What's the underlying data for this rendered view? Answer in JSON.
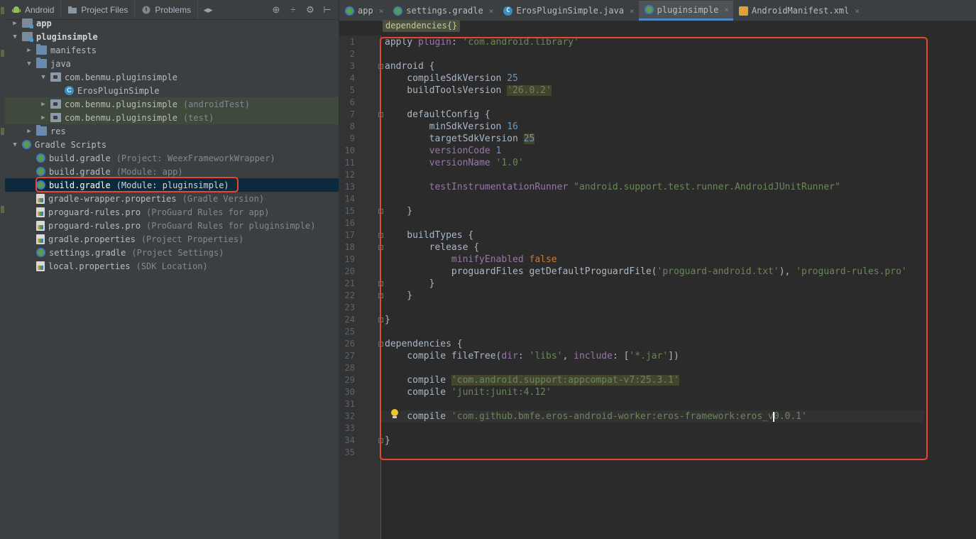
{
  "colors": {
    "panel_bg": "#3c3f41",
    "editor_bg": "#2b2b2b",
    "selection": "#0d293e",
    "highlight_border": "#e8462f",
    "keyword": "#cc7832",
    "string": "#6a8759",
    "number": "#6897bb",
    "property": "#9876aa"
  },
  "project_toolbar": {
    "tabs": [
      {
        "label": "Android",
        "icon": "android-icon"
      },
      {
        "label": "Project Files",
        "icon": "folder-icon"
      },
      {
        "label": "Problems",
        "icon": "problems-icon"
      }
    ],
    "icons": [
      "scroll-arrows-icon",
      "target-icon",
      "collapse-icon",
      "gear-icon",
      "hide-icon"
    ]
  },
  "tree": [
    {
      "label": "app",
      "hint": "",
      "icon": "module-icon",
      "arrow": "▶",
      "bold": true
    },
    {
      "label": "pluginsimple",
      "hint": "",
      "icon": "module-icon",
      "arrow": "▼",
      "bold": true
    },
    {
      "label": "manifests",
      "hint": "",
      "icon": "folder-icon",
      "arrow": "▶"
    },
    {
      "label": "java",
      "hint": "",
      "icon": "folder-icon",
      "arrow": "▼"
    },
    {
      "label": "com.benmu.pluginsimple",
      "hint": "",
      "icon": "package-icon",
      "arrow": "▼"
    },
    {
      "label": "ErosPluginSimple",
      "hint": "",
      "icon": "class-icon",
      "arrow": ""
    },
    {
      "label": "com.benmu.pluginsimple",
      "hint": "(androidTest)",
      "icon": "package-icon",
      "arrow": "▶"
    },
    {
      "label": "com.benmu.pluginsimple",
      "hint": "(test)",
      "icon": "package-icon",
      "arrow": "▶"
    },
    {
      "label": "res",
      "hint": "",
      "icon": "folder-icon",
      "arrow": "▶"
    },
    {
      "label": "Gradle Scripts",
      "hint": "",
      "icon": "gradle-icon",
      "arrow": "▼"
    },
    {
      "label": "build.gradle",
      "hint": "(Project: WeexFrameworkWrapper)",
      "icon": "gradle-icon",
      "arrow": ""
    },
    {
      "label": "build.gradle",
      "hint": "(Module: app)",
      "icon": "gradle-icon",
      "arrow": ""
    },
    {
      "label": "build.gradle",
      "hint": "(Module: pluginsimple)",
      "icon": "gradle-icon",
      "arrow": ""
    },
    {
      "label": "gradle-wrapper.properties",
      "hint": "(Gradle Version)",
      "icon": "properties-icon",
      "arrow": ""
    },
    {
      "label": "proguard-rules.pro",
      "hint": "(ProGuard Rules for app)",
      "icon": "properties-icon",
      "arrow": ""
    },
    {
      "label": "proguard-rules.pro",
      "hint": "(ProGuard Rules for pluginsimple)",
      "icon": "properties-icon",
      "arrow": ""
    },
    {
      "label": "gradle.properties",
      "hint": "(Project Properties)",
      "icon": "properties-icon",
      "arrow": ""
    },
    {
      "label": "settings.gradle",
      "hint": "(Project Settings)",
      "icon": "gradle-icon",
      "arrow": ""
    },
    {
      "label": "local.properties",
      "hint": "(SDK Location)",
      "icon": "properties-icon",
      "arrow": ""
    }
  ],
  "selected_item": "build.gradle (Module: pluginsimple)",
  "editor_tabs": [
    {
      "label": "app",
      "icon": "gradle-icon",
      "active": false
    },
    {
      "label": "settings.gradle",
      "icon": "gradle-icon",
      "active": false
    },
    {
      "label": "ErosPluginSimple.java",
      "icon": "class-icon",
      "active": false
    },
    {
      "label": "pluginsimple",
      "icon": "gradle-icon",
      "active": true
    },
    {
      "label": "AndroidManifest.xml",
      "icon": "xml-icon",
      "active": false
    }
  ],
  "breadcrumb": "dependencies{}",
  "code_lines": [
    "apply plugin: 'com.android.library'",
    "",
    "android {",
    "    compileSdkVersion 25",
    "    buildToolsVersion '26.0.2'",
    "",
    "    defaultConfig {",
    "        minSdkVersion 16",
    "        targetSdkVersion 25",
    "        versionCode 1",
    "        versionName '1.0'",
    "",
    "        testInstrumentationRunner \"android.support.test.runner.AndroidJUnitRunner\"",
    "",
    "    }",
    "",
    "    buildTypes {",
    "        release {",
    "            minifyEnabled false",
    "            proguardFiles getDefaultProguardFile('proguard-android.txt'), 'proguard-rules.pro'",
    "        }",
    "    }",
    "",
    "}",
    "",
    "dependencies {",
    "    compile fileTree(dir: 'libs', include: ['*.jar'])",
    "",
    "    compile 'com.android.support:appcompat-v7:25.3.1'",
    "    compile 'junit:junit:4.12'",
    "",
    "    compile 'com.github.bmfe.eros-android-worker:eros-framework:eros_v0.0.1'",
    "",
    "}",
    ""
  ],
  "current_line": 32
}
